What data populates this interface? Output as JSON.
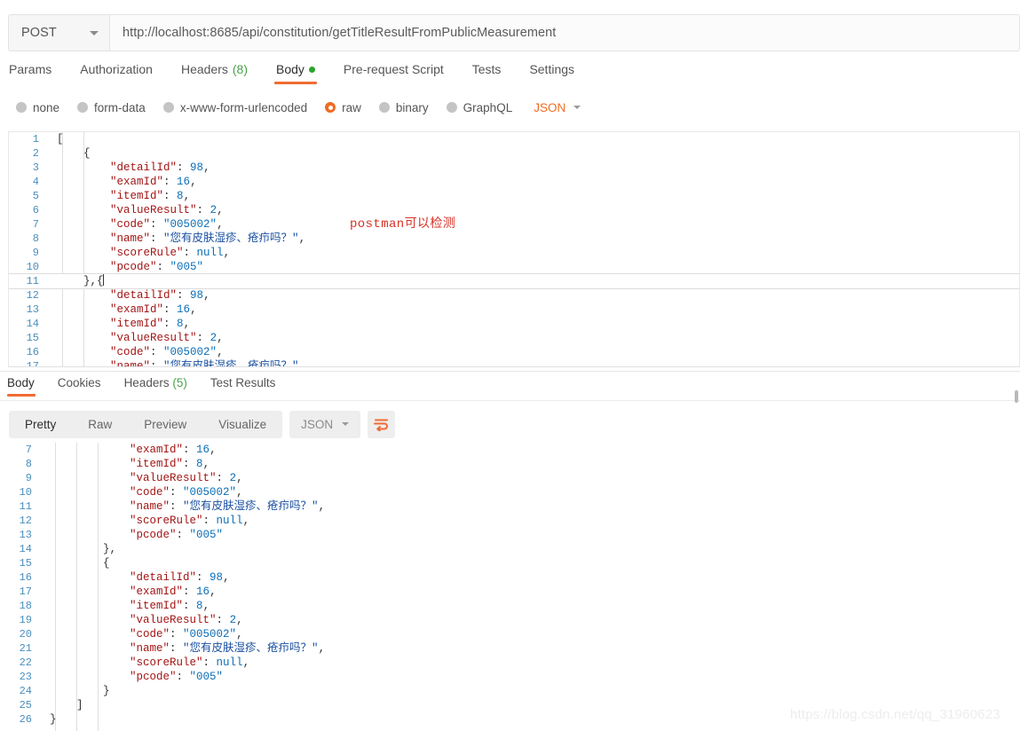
{
  "request": {
    "method": "POST",
    "url": "http://localhost:8685/api/constitution/getTitleResultFromPublicMeasurement",
    "tabs": [
      {
        "label": "Params",
        "count": "",
        "dot": false,
        "active": false
      },
      {
        "label": "Authorization",
        "count": "",
        "dot": false,
        "active": false
      },
      {
        "label": "Headers",
        "count": "(8)",
        "dot": false,
        "active": false
      },
      {
        "label": "Body",
        "count": "",
        "dot": true,
        "active": true
      },
      {
        "label": "Pre-request Script",
        "count": "",
        "dot": false,
        "active": false
      },
      {
        "label": "Tests",
        "count": "",
        "dot": false,
        "active": false
      },
      {
        "label": "Settings",
        "count": "",
        "dot": false,
        "active": false
      }
    ],
    "body_types": [
      {
        "label": "none",
        "selected": false
      },
      {
        "label": "form-data",
        "selected": false
      },
      {
        "label": "x-www-form-urlencoded",
        "selected": false
      },
      {
        "label": "raw",
        "selected": true
      },
      {
        "label": "binary",
        "selected": false
      },
      {
        "label": "GraphQL",
        "selected": false
      }
    ],
    "raw_language": "JSON",
    "body_lines": [
      {
        "n": "1",
        "tokens": [
          {
            "t": "[",
            "c": "p"
          }
        ]
      },
      {
        "n": "2",
        "tokens": [
          {
            "t": "    {",
            "c": "p"
          }
        ]
      },
      {
        "n": "3",
        "tokens": [
          {
            "t": "        ",
            "c": "p"
          },
          {
            "t": "\"detailId\"",
            "c": "k"
          },
          {
            "t": ": ",
            "c": "p"
          },
          {
            "t": "98",
            "c": "n"
          },
          {
            "t": ",",
            "c": "p"
          }
        ]
      },
      {
        "n": "4",
        "tokens": [
          {
            "t": "        ",
            "c": "p"
          },
          {
            "t": "\"examId\"",
            "c": "k"
          },
          {
            "t": ": ",
            "c": "p"
          },
          {
            "t": "16",
            "c": "n"
          },
          {
            "t": ",",
            "c": "p"
          }
        ]
      },
      {
        "n": "5",
        "tokens": [
          {
            "t": "        ",
            "c": "p"
          },
          {
            "t": "\"itemId\"",
            "c": "k"
          },
          {
            "t": ": ",
            "c": "p"
          },
          {
            "t": "8",
            "c": "n"
          },
          {
            "t": ",",
            "c": "p"
          }
        ]
      },
      {
        "n": "6",
        "tokens": [
          {
            "t": "        ",
            "c": "p"
          },
          {
            "t": "\"valueResult\"",
            "c": "k"
          },
          {
            "t": ": ",
            "c": "p"
          },
          {
            "t": "2",
            "c": "n"
          },
          {
            "t": ",",
            "c": "p"
          }
        ]
      },
      {
        "n": "7",
        "tokens": [
          {
            "t": "        ",
            "c": "p"
          },
          {
            "t": "\"code\"",
            "c": "k"
          },
          {
            "t": ": ",
            "c": "p"
          },
          {
            "t": "\"005002\"",
            "c": "s"
          },
          {
            "t": ",",
            "c": "p"
          }
        ]
      },
      {
        "n": "8",
        "tokens": [
          {
            "t": "        ",
            "c": "p"
          },
          {
            "t": "\"name\"",
            "c": "k"
          },
          {
            "t": ": ",
            "c": "p"
          },
          {
            "t": "\"您有皮肤湿疹、疮疖吗？\"",
            "c": "cn"
          },
          {
            "t": ",",
            "c": "p"
          }
        ]
      },
      {
        "n": "9",
        "tokens": [
          {
            "t": "        ",
            "c": "p"
          },
          {
            "t": "\"scoreRule\"",
            "c": "k"
          },
          {
            "t": ": ",
            "c": "p"
          },
          {
            "t": "null",
            "c": "nl"
          },
          {
            "t": ",",
            "c": "p"
          }
        ]
      },
      {
        "n": "10",
        "tokens": [
          {
            "t": "        ",
            "c": "p"
          },
          {
            "t": "\"pcode\"",
            "c": "k"
          },
          {
            "t": ": ",
            "c": "p"
          },
          {
            "t": "\"005\"",
            "c": "s"
          }
        ]
      },
      {
        "n": "11",
        "tokens": [
          {
            "t": "    },{",
            "c": "p"
          }
        ],
        "cursor": true
      },
      {
        "n": "12",
        "tokens": [
          {
            "t": "        ",
            "c": "p"
          },
          {
            "t": "\"detailId\"",
            "c": "k"
          },
          {
            "t": ": ",
            "c": "p"
          },
          {
            "t": "98",
            "c": "n"
          },
          {
            "t": ",",
            "c": "p"
          }
        ]
      },
      {
        "n": "13",
        "tokens": [
          {
            "t": "        ",
            "c": "p"
          },
          {
            "t": "\"examId\"",
            "c": "k"
          },
          {
            "t": ": ",
            "c": "p"
          },
          {
            "t": "16",
            "c": "n"
          },
          {
            "t": ",",
            "c": "p"
          }
        ]
      },
      {
        "n": "14",
        "tokens": [
          {
            "t": "        ",
            "c": "p"
          },
          {
            "t": "\"itemId\"",
            "c": "k"
          },
          {
            "t": ": ",
            "c": "p"
          },
          {
            "t": "8",
            "c": "n"
          },
          {
            "t": ",",
            "c": "p"
          }
        ]
      },
      {
        "n": "15",
        "tokens": [
          {
            "t": "        ",
            "c": "p"
          },
          {
            "t": "\"valueResult\"",
            "c": "k"
          },
          {
            "t": ": ",
            "c": "p"
          },
          {
            "t": "2",
            "c": "n"
          },
          {
            "t": ",",
            "c": "p"
          }
        ]
      },
      {
        "n": "16",
        "tokens": [
          {
            "t": "        ",
            "c": "p"
          },
          {
            "t": "\"code\"",
            "c": "k"
          },
          {
            "t": ": ",
            "c": "p"
          },
          {
            "t": "\"005002\"",
            "c": "s"
          },
          {
            "t": ",",
            "c": "p"
          }
        ]
      },
      {
        "n": "17",
        "tokens": [
          {
            "t": "        ",
            "c": "p"
          },
          {
            "t": "\"name\"",
            "c": "k"
          },
          {
            "t": ": ",
            "c": "p"
          },
          {
            "t": "\"您有皮肤湿疹、疮疖吗？\"",
            "c": "cn"
          },
          {
            "t": ",",
            "c": "p"
          }
        ]
      }
    ]
  },
  "annotation": {
    "text": "postman可以检测",
    "color": "#d93025"
  },
  "response": {
    "tabs": [
      {
        "label": "Body",
        "count": "",
        "active": true
      },
      {
        "label": "Cookies",
        "count": "",
        "active": false
      },
      {
        "label": "Headers",
        "count": "(5)",
        "active": false
      },
      {
        "label": "Test Results",
        "count": "",
        "active": false
      }
    ],
    "view_modes": [
      {
        "label": "Pretty",
        "active": true
      },
      {
        "label": "Raw",
        "active": false
      },
      {
        "label": "Preview",
        "active": false
      },
      {
        "label": "Visualize",
        "active": false
      }
    ],
    "format": "JSON",
    "wrap_icon": "word-wrap-icon",
    "body_lines": [
      {
        "n": "7",
        "tokens": [
          {
            "t": "            ",
            "c": "p"
          },
          {
            "t": "\"examId\"",
            "c": "k"
          },
          {
            "t": ": ",
            "c": "p"
          },
          {
            "t": "16",
            "c": "n"
          },
          {
            "t": ",",
            "c": "p"
          }
        ]
      },
      {
        "n": "8",
        "tokens": [
          {
            "t": "            ",
            "c": "p"
          },
          {
            "t": "\"itemId\"",
            "c": "k"
          },
          {
            "t": ": ",
            "c": "p"
          },
          {
            "t": "8",
            "c": "n"
          },
          {
            "t": ",",
            "c": "p"
          }
        ]
      },
      {
        "n": "9",
        "tokens": [
          {
            "t": "            ",
            "c": "p"
          },
          {
            "t": "\"valueResult\"",
            "c": "k"
          },
          {
            "t": ": ",
            "c": "p"
          },
          {
            "t": "2",
            "c": "n"
          },
          {
            "t": ",",
            "c": "p"
          }
        ]
      },
      {
        "n": "10",
        "tokens": [
          {
            "t": "            ",
            "c": "p"
          },
          {
            "t": "\"code\"",
            "c": "k"
          },
          {
            "t": ": ",
            "c": "p"
          },
          {
            "t": "\"005002\"",
            "c": "s"
          },
          {
            "t": ",",
            "c": "p"
          }
        ]
      },
      {
        "n": "11",
        "tokens": [
          {
            "t": "            ",
            "c": "p"
          },
          {
            "t": "\"name\"",
            "c": "k"
          },
          {
            "t": ": ",
            "c": "p"
          },
          {
            "t": "\"您有皮肤湿疹、疮疖吗？\"",
            "c": "cn"
          },
          {
            "t": ",",
            "c": "p"
          }
        ]
      },
      {
        "n": "12",
        "tokens": [
          {
            "t": "            ",
            "c": "p"
          },
          {
            "t": "\"scoreRule\"",
            "c": "k"
          },
          {
            "t": ": ",
            "c": "p"
          },
          {
            "t": "null",
            "c": "nl"
          },
          {
            "t": ",",
            "c": "p"
          }
        ]
      },
      {
        "n": "13",
        "tokens": [
          {
            "t": "            ",
            "c": "p"
          },
          {
            "t": "\"pcode\"",
            "c": "k"
          },
          {
            "t": ": ",
            "c": "p"
          },
          {
            "t": "\"005\"",
            "c": "s"
          }
        ]
      },
      {
        "n": "14",
        "tokens": [
          {
            "t": "        },",
            "c": "p"
          }
        ]
      },
      {
        "n": "15",
        "tokens": [
          {
            "t": "        {",
            "c": "p"
          }
        ]
      },
      {
        "n": "16",
        "tokens": [
          {
            "t": "            ",
            "c": "p"
          },
          {
            "t": "\"detailId\"",
            "c": "k"
          },
          {
            "t": ": ",
            "c": "p"
          },
          {
            "t": "98",
            "c": "n"
          },
          {
            "t": ",",
            "c": "p"
          }
        ]
      },
      {
        "n": "17",
        "tokens": [
          {
            "t": "            ",
            "c": "p"
          },
          {
            "t": "\"examId\"",
            "c": "k"
          },
          {
            "t": ": ",
            "c": "p"
          },
          {
            "t": "16",
            "c": "n"
          },
          {
            "t": ",",
            "c": "p"
          }
        ]
      },
      {
        "n": "18",
        "tokens": [
          {
            "t": "            ",
            "c": "p"
          },
          {
            "t": "\"itemId\"",
            "c": "k"
          },
          {
            "t": ": ",
            "c": "p"
          },
          {
            "t": "8",
            "c": "n"
          },
          {
            "t": ",",
            "c": "p"
          }
        ]
      },
      {
        "n": "19",
        "tokens": [
          {
            "t": "            ",
            "c": "p"
          },
          {
            "t": "\"valueResult\"",
            "c": "k"
          },
          {
            "t": ": ",
            "c": "p"
          },
          {
            "t": "2",
            "c": "n"
          },
          {
            "t": ",",
            "c": "p"
          }
        ]
      },
      {
        "n": "20",
        "tokens": [
          {
            "t": "            ",
            "c": "p"
          },
          {
            "t": "\"code\"",
            "c": "k"
          },
          {
            "t": ": ",
            "c": "p"
          },
          {
            "t": "\"005002\"",
            "c": "s"
          },
          {
            "t": ",",
            "c": "p"
          }
        ]
      },
      {
        "n": "21",
        "tokens": [
          {
            "t": "            ",
            "c": "p"
          },
          {
            "t": "\"name\"",
            "c": "k"
          },
          {
            "t": ": ",
            "c": "p"
          },
          {
            "t": "\"您有皮肤湿疹、疮疖吗？\"",
            "c": "cn"
          },
          {
            "t": ",",
            "c": "p"
          }
        ]
      },
      {
        "n": "22",
        "tokens": [
          {
            "t": "            ",
            "c": "p"
          },
          {
            "t": "\"scoreRule\"",
            "c": "k"
          },
          {
            "t": ": ",
            "c": "p"
          },
          {
            "t": "null",
            "c": "nl"
          },
          {
            "t": ",",
            "c": "p"
          }
        ]
      },
      {
        "n": "23",
        "tokens": [
          {
            "t": "            ",
            "c": "p"
          },
          {
            "t": "\"pcode\"",
            "c": "k"
          },
          {
            "t": ": ",
            "c": "p"
          },
          {
            "t": "\"005\"",
            "c": "s"
          }
        ]
      },
      {
        "n": "24",
        "tokens": [
          {
            "t": "        }",
            "c": "p"
          }
        ]
      },
      {
        "n": "25",
        "tokens": [
          {
            "t": "    ]",
            "c": "p"
          }
        ]
      },
      {
        "n": "26",
        "tokens": [
          {
            "t": "}",
            "c": "p"
          }
        ]
      }
    ]
  },
  "watermark": "https://blog.csdn.net/qq_31960623"
}
